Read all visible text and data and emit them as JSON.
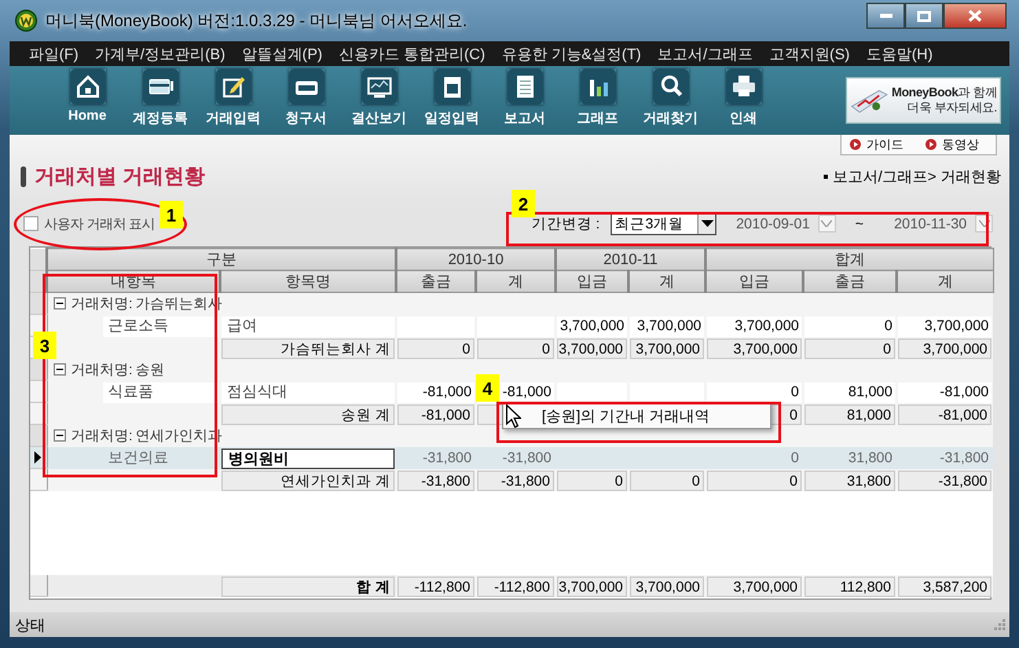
{
  "window": {
    "title": "머니북(MoneyBook) 버전:1.0.3.29 - 머니북님 어서오세요."
  },
  "menu": [
    "파일(F)",
    "가계부/정보관리(B)",
    "알뜰설계(P)",
    "신용카드 통합관리(C)",
    "유용한 기능&설정(T)",
    "보고서/그래프",
    "고객지원(S)",
    "도움말(H)"
  ],
  "toolbar": [
    "Home",
    "계정등록",
    "거래입력",
    "청구서",
    "결산보기",
    "일정입력",
    "보고서",
    "그래프",
    "거래찾기",
    "인쇄"
  ],
  "promo": {
    "lines": [
      "**MoneyBook**과 함께",
      "더욱 부자되세요."
    ]
  },
  "help_links": [
    "가이드",
    "동영상"
  ],
  "page": {
    "title": "거래처별 거래현황",
    "breadcrumb": "보고서/그래프> 거래현황"
  },
  "filter": {
    "custom_partners": {
      "label": "사용자 거래처 표시",
      "checked": false
    },
    "period_label": "기간변경 :",
    "period": "최근3개월",
    "start_date": "2010-09-01",
    "separator": "~",
    "end_date": "2010-11-30"
  },
  "table": {
    "header_groups": [
      {
        "label": "구분",
        "columns": [
          "내항목",
          "항목명"
        ]
      },
      {
        "label": "2010-10",
        "columns": [
          "출금",
          "계"
        ]
      },
      {
        "label": "2010-11",
        "columns": [
          "입금",
          "계"
        ]
      },
      {
        "label": "합계",
        "columns": [
          "입금",
          "출금",
          "계"
        ]
      }
    ],
    "groups": [
      {
        "name": "거래처명: 가슴뛰는회사",
        "expanded": true,
        "rows": [
          {
            "category": "근로소득",
            "item": "급여",
            "selected": false,
            "values": [
              {
                "kind": "blank"
              },
              {
                "kind": "blank"
              },
              {
                "kind": "value",
                "text": "3,700,000"
              },
              {
                "kind": "value",
                "text": "3,700,000"
              },
              {
                "kind": "value",
                "text": "3,700,000"
              },
              {
                "kind": "value",
                "text": "0"
              },
              {
                "kind": "value",
                "text": "3,700,000"
              }
            ]
          }
        ],
        "subtotal": {
          "label": "가슴뛰는회사 계",
          "values": [
            {
              "kind": "value",
              "text": "0"
            },
            {
              "kind": "value",
              "text": "0"
            },
            {
              "kind": "value",
              "text": "3,700,000"
            },
            {
              "kind": "value",
              "text": "3,700,000"
            },
            {
              "kind": "value",
              "text": "3,700,000"
            },
            {
              "kind": "value",
              "text": "0"
            },
            {
              "kind": "value",
              "text": "3,700,000"
            }
          ]
        }
      },
      {
        "name": "거래처명: 송원",
        "expanded": true,
        "rows": [
          {
            "category": "식료품",
            "item": "점심식대",
            "selected": false,
            "values": [
              {
                "kind": "value",
                "text": "-81,000"
              },
              {
                "kind": "value",
                "text": "-81,000"
              },
              {
                "kind": "blank"
              },
              {
                "kind": "blank"
              },
              {
                "kind": "value",
                "text": "0"
              },
              {
                "kind": "value",
                "text": "81,000"
              },
              {
                "kind": "value",
                "text": "-81,000"
              }
            ]
          }
        ],
        "subtotal": {
          "label": "송원 계",
          "values": [
            {
              "kind": "value",
              "text": "-81,000"
            },
            {
              "kind": "hidden"
            },
            {
              "kind": "covered"
            },
            {
              "kind": "covered"
            },
            {
              "kind": "value",
              "text": "0"
            },
            {
              "kind": "value",
              "text": "81,000"
            },
            {
              "kind": "value",
              "text": "-81,000"
            }
          ]
        }
      },
      {
        "name": "거래처명: 연세가인치과",
        "expanded": true,
        "rows": [
          {
            "category": "보건의료",
            "item": "병의원비",
            "selected": true,
            "values": [
              {
                "kind": "value",
                "text": "-31,800"
              },
              {
                "kind": "value",
                "text": "-31,800"
              },
              {
                "kind": "blank"
              },
              {
                "kind": "blank"
              },
              {
                "kind": "value",
                "text": "0"
              },
              {
                "kind": "value",
                "text": "31,800"
              },
              {
                "kind": "value",
                "text": "-31,800"
              }
            ]
          }
        ],
        "subtotal": {
          "label": "연세가인치과 계",
          "values": [
            {
              "kind": "value",
              "text": "-31,800"
            },
            {
              "kind": "value",
              "text": "-31,800"
            },
            {
              "kind": "value",
              "text": "0"
            },
            {
              "kind": "value",
              "text": "0"
            },
            {
              "kind": "value",
              "text": "0"
            },
            {
              "kind": "value",
              "text": "31,800"
            },
            {
              "kind": "value",
              "text": "-31,800"
            }
          ]
        }
      }
    ],
    "total": {
      "label": "합 계",
      "values": [
        {
          "kind": "value",
          "text": "-112,800"
        },
        {
          "kind": "value",
          "text": "-112,800"
        },
        {
          "kind": "value",
          "text": "3,700,000"
        },
        {
          "kind": "value",
          "text": "3,700,000"
        },
        {
          "kind": "value",
          "text": "3,700,000"
        },
        {
          "kind": "value",
          "text": "112,800"
        },
        {
          "kind": "value",
          "text": "3,587,200"
        }
      ]
    }
  },
  "context_menu": {
    "items": [
      "[송원]의 기간내 거래내역"
    ]
  },
  "annotations": [
    "1",
    "2",
    "3",
    "4"
  ],
  "status_bar": "상태"
}
